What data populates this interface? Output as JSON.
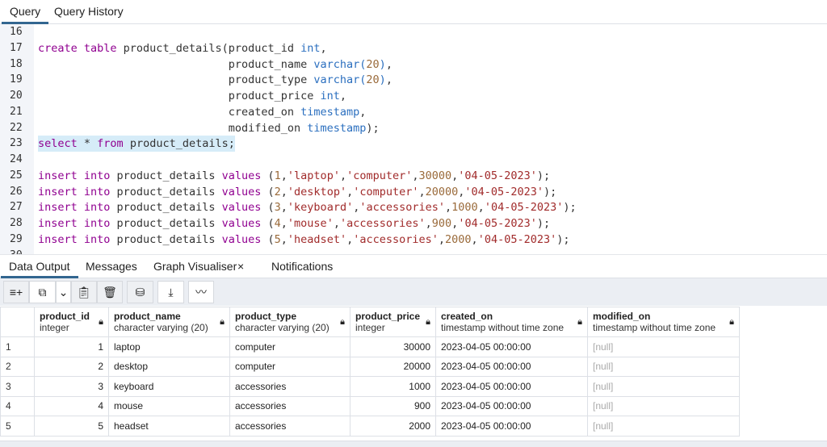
{
  "tabs": {
    "query": "Query",
    "history": "Query History"
  },
  "editor": {
    "lines": [
      {
        "n": "16",
        "t": []
      },
      {
        "n": "17",
        "t": [
          [
            "kw",
            "create table "
          ],
          [
            "id",
            "product_details(product_id "
          ],
          [
            "ty",
            "int"
          ],
          [
            "id",
            ","
          ]
        ]
      },
      {
        "n": "18",
        "t": [
          [
            "id",
            "                             product_name "
          ],
          [
            "ty",
            "varchar("
          ],
          [
            "nu",
            "20"
          ],
          [
            "ty",
            ")"
          ],
          [
            "id",
            ","
          ]
        ]
      },
      {
        "n": "19",
        "t": [
          [
            "id",
            "                             product_type "
          ],
          [
            "ty",
            "varchar("
          ],
          [
            "nu",
            "20"
          ],
          [
            "ty",
            ")"
          ],
          [
            "id",
            ","
          ]
        ]
      },
      {
        "n": "20",
        "t": [
          [
            "id",
            "                             product_price "
          ],
          [
            "ty",
            "int"
          ],
          [
            "id",
            ","
          ]
        ]
      },
      {
        "n": "21",
        "t": [
          [
            "id",
            "                             created_on "
          ],
          [
            "ty",
            "timestamp"
          ],
          [
            "id",
            ","
          ]
        ]
      },
      {
        "n": "22",
        "t": [
          [
            "id",
            "                             modified_on "
          ],
          [
            "ty",
            "timestamp"
          ],
          [
            "id",
            ");"
          ]
        ]
      },
      {
        "n": "23",
        "hl": true,
        "t": [
          [
            "kw",
            "select"
          ],
          [
            "id",
            " * "
          ],
          [
            "kw",
            "from "
          ],
          [
            "id",
            "product_details;"
          ]
        ]
      },
      {
        "n": "24",
        "t": []
      },
      {
        "n": "25",
        "t": [
          [
            "kw",
            "insert into "
          ],
          [
            "id",
            "product_details "
          ],
          [
            "kw",
            "values "
          ],
          [
            "id",
            "("
          ],
          [
            "nu",
            "1"
          ],
          [
            "id",
            ","
          ],
          [
            "st",
            "'laptop'"
          ],
          [
            "id",
            ","
          ],
          [
            "st",
            "'computer'"
          ],
          [
            "id",
            ","
          ],
          [
            "nu",
            "30000"
          ],
          [
            "id",
            ","
          ],
          [
            "st",
            "'04-05-2023'"
          ],
          [
            "id",
            ");"
          ]
        ]
      },
      {
        "n": "26",
        "t": [
          [
            "kw",
            "insert into "
          ],
          [
            "id",
            "product_details "
          ],
          [
            "kw",
            "values "
          ],
          [
            "id",
            "("
          ],
          [
            "nu",
            "2"
          ],
          [
            "id",
            ","
          ],
          [
            "st",
            "'desktop'"
          ],
          [
            "id",
            ","
          ],
          [
            "st",
            "'computer'"
          ],
          [
            "id",
            ","
          ],
          [
            "nu",
            "20000"
          ],
          [
            "id",
            ","
          ],
          [
            "st",
            "'04-05-2023'"
          ],
          [
            "id",
            ");"
          ]
        ]
      },
      {
        "n": "27",
        "t": [
          [
            "kw",
            "insert into "
          ],
          [
            "id",
            "product_details "
          ],
          [
            "kw",
            "values "
          ],
          [
            "id",
            "("
          ],
          [
            "nu",
            "3"
          ],
          [
            "id",
            ","
          ],
          [
            "st",
            "'keyboard'"
          ],
          [
            "id",
            ","
          ],
          [
            "st",
            "'accessories'"
          ],
          [
            "id",
            ","
          ],
          [
            "nu",
            "1000"
          ],
          [
            "id",
            ","
          ],
          [
            "st",
            "'04-05-2023'"
          ],
          [
            "id",
            ");"
          ]
        ]
      },
      {
        "n": "28",
        "t": [
          [
            "kw",
            "insert into "
          ],
          [
            "id",
            "product_details "
          ],
          [
            "kw",
            "values "
          ],
          [
            "id",
            "("
          ],
          [
            "nu",
            "4"
          ],
          [
            "id",
            ","
          ],
          [
            "st",
            "'mouse'"
          ],
          [
            "id",
            ","
          ],
          [
            "st",
            "'accessories'"
          ],
          [
            "id",
            ","
          ],
          [
            "nu",
            "900"
          ],
          [
            "id",
            ","
          ],
          [
            "st",
            "'04-05-2023'"
          ],
          [
            "id",
            ");"
          ]
        ]
      },
      {
        "n": "29",
        "t": [
          [
            "kw",
            "insert into "
          ],
          [
            "id",
            "product_details "
          ],
          [
            "kw",
            "values "
          ],
          [
            "id",
            "("
          ],
          [
            "nu",
            "5"
          ],
          [
            "id",
            ","
          ],
          [
            "st",
            "'headset'"
          ],
          [
            "id",
            ","
          ],
          [
            "st",
            "'accessories'"
          ],
          [
            "id",
            ","
          ],
          [
            "nu",
            "2000"
          ],
          [
            "id",
            ","
          ],
          [
            "st",
            "'04-05-2023'"
          ],
          [
            "id",
            ");"
          ]
        ]
      },
      {
        "n": "30",
        "t": []
      }
    ]
  },
  "panel": {
    "tabs": {
      "data_output": "Data Output",
      "messages": "Messages",
      "graph": "Graph Visualiser",
      "graph_close": "×",
      "notifications": "Notifications"
    }
  },
  "grid": {
    "columns": [
      {
        "name": "product_id",
        "type": "integer"
      },
      {
        "name": "product_name",
        "type": "character varying (20)"
      },
      {
        "name": "product_type",
        "type": "character varying (20)"
      },
      {
        "name": "product_price",
        "type": "integer"
      },
      {
        "name": "created_on",
        "type": "timestamp without time zone"
      },
      {
        "name": "modified_on",
        "type": "timestamp without time zone"
      }
    ],
    "rows": [
      [
        "1",
        "1",
        "laptop",
        "computer",
        "30000",
        "2023-04-05 00:00:00",
        "[null]"
      ],
      [
        "2",
        "2",
        "desktop",
        "computer",
        "20000",
        "2023-04-05 00:00:00",
        "[null]"
      ],
      [
        "3",
        "3",
        "keyboard",
        "accessories",
        "1000",
        "2023-04-05 00:00:00",
        "[null]"
      ],
      [
        "4",
        "4",
        "mouse",
        "accessories",
        "900",
        "2023-04-05 00:00:00",
        "[null]"
      ],
      [
        "5",
        "5",
        "headset",
        "accessories",
        "2000",
        "2023-04-05 00:00:00",
        "[null]"
      ]
    ]
  }
}
